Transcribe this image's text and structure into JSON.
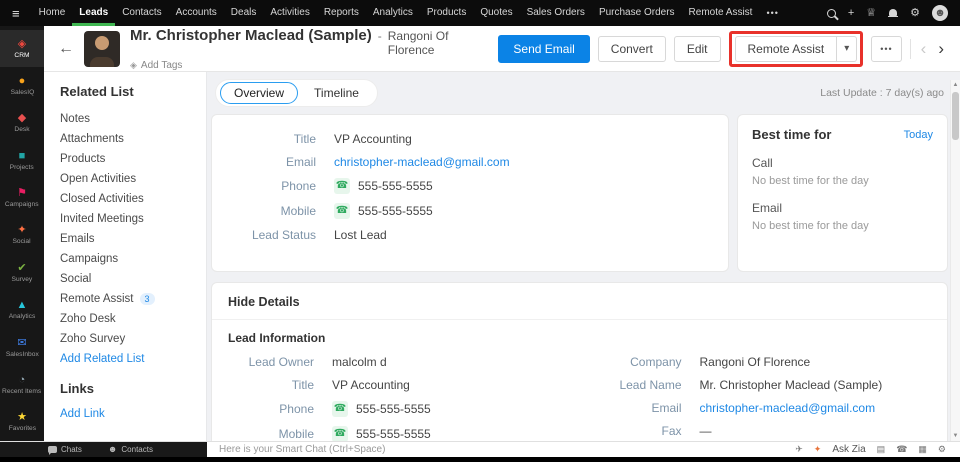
{
  "colors": {
    "topnav_bg": "#0c0c0c",
    "nav_active_underline": "#3fb651",
    "accent_blue": "#1e88e5",
    "primary_button_blue": "#0b83e6",
    "phone_icon_green": "#2faa5f",
    "annotation_red": "#e8312a"
  },
  "topnav": {
    "items": [
      "Home",
      "Leads",
      "Contacts",
      "Accounts",
      "Deals",
      "Activities",
      "Reports",
      "Analytics",
      "Products",
      "Quotes",
      "Sales Orders",
      "Purchase Orders",
      "Remote Assist"
    ],
    "active_item": "Leads",
    "more_icon": "•••"
  },
  "icons": {
    "hamburger": "≡",
    "plus": "+",
    "achievements": "♕",
    "gear": "⚙",
    "avatar": "☻",
    "back": "←",
    "tag": "◈",
    "caret_down": "▾",
    "more_dots": "•••",
    "prev": "‹",
    "next": "›",
    "phone": "☎",
    "scroll_up": "▲",
    "scroll_down": "▼",
    "send": "✈",
    "zia": "✦",
    "grid": "▤",
    "call": "☎",
    "panel": "▦",
    "settings": "⚙",
    "contacts": "☻"
  },
  "sidebar": {
    "items": [
      {
        "label": "CRM",
        "icon": "◈",
        "color": "#f0483e",
        "active": true
      },
      {
        "label": "SalesIQ",
        "icon": "●",
        "color": "#f7a21b"
      },
      {
        "label": "Desk",
        "icon": "◆",
        "color": "#e8504f"
      },
      {
        "label": "Projects",
        "icon": "■",
        "color": "#21a5a5"
      },
      {
        "label": "Campaigns",
        "icon": "⚑",
        "color": "#e91e63"
      },
      {
        "label": "Social",
        "icon": "✦",
        "color": "#ff7043"
      },
      {
        "label": "Survey",
        "icon": "✔",
        "color": "#7cb342"
      },
      {
        "label": "Analytics",
        "icon": "▲",
        "color": "#26c6da"
      },
      {
        "label": "SalesInbox",
        "icon": "✉",
        "color": "#4285f4"
      },
      {
        "label": "Recent Items",
        "icon": "◔",
        "color": "#90a4ae"
      },
      {
        "label": "Favorites",
        "icon": "★",
        "color": "#fdd835"
      }
    ]
  },
  "header": {
    "title": "Mr. Christopher Maclead (Sample)",
    "separator": "-",
    "company": "Rangoni Of Florence",
    "add_tags": "Add Tags",
    "buttons": {
      "send_email": "Send Email",
      "convert": "Convert",
      "edit": "Edit",
      "remote_assist": "Remote Assist"
    }
  },
  "related_list": {
    "title": "Related List",
    "items": [
      {
        "label": "Notes"
      },
      {
        "label": "Attachments"
      },
      {
        "label": "Products"
      },
      {
        "label": "Open Activities"
      },
      {
        "label": "Closed Activities"
      },
      {
        "label": "Invited Meetings"
      },
      {
        "label": "Emails"
      },
      {
        "label": "Campaigns"
      },
      {
        "label": "Social"
      },
      {
        "label": "Remote Assist",
        "badge": "3"
      },
      {
        "label": "Zoho Desk"
      },
      {
        "label": "Zoho Survey"
      }
    ],
    "add_related_list": "Add Related List",
    "links_title": "Links",
    "add_link": "Add Link"
  },
  "main": {
    "tabs": [
      {
        "label": "Overview"
      },
      {
        "label": "Timeline"
      }
    ],
    "last_update": "Last Update : 7 day(s) ago",
    "summary_fields": [
      {
        "label": "Title",
        "value": "VP Accounting"
      },
      {
        "label": "Email",
        "value": "christopher-maclead@gmail.com"
      },
      {
        "label": "Phone",
        "value": "555-555-5555"
      },
      {
        "label": "Mobile",
        "value": "555-555-5555"
      },
      {
        "label": "Lead Status",
        "value": "Lost Lead"
      }
    ],
    "best_time": {
      "title": "Best time for",
      "action": "Today",
      "rows": [
        {
          "label": "Call",
          "value": "No best time for the day"
        },
        {
          "label": "Email",
          "value": "No best time for the day"
        }
      ]
    },
    "details": {
      "toggle_label": "Hide Details",
      "section_title": "Lead Information",
      "left": [
        {
          "label": "Lead Owner",
          "value": "malcolm d"
        },
        {
          "label": "Title",
          "value": "VP Accounting"
        },
        {
          "label": "Phone",
          "value": "555-555-5555"
        },
        {
          "label": "Mobile",
          "value": "555-555-5555"
        }
      ],
      "right": [
        {
          "label": "Company",
          "value": "Rangoni Of Florence"
        },
        {
          "label": "Lead Name",
          "value": "Mr. Christopher Maclead (Sample)"
        },
        {
          "label": "Email",
          "value": "christopher-maclead@gmail.com"
        },
        {
          "label": "Fax",
          "value": "—"
        }
      ]
    }
  },
  "bottombar": {
    "chats_label": "Chats",
    "contacts_label": "Contacts",
    "smart_chat_placeholder": "Here is your Smart Chat (Ctrl+Space)",
    "ask_zia": "Ask Zia"
  }
}
